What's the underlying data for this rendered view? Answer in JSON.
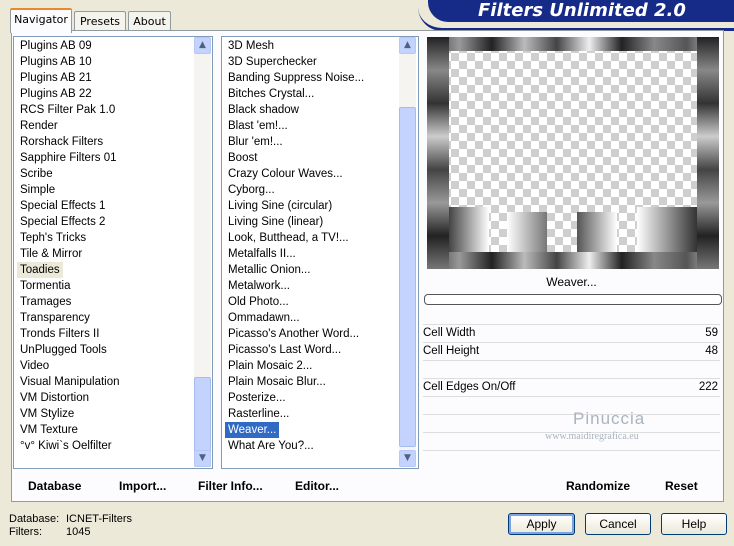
{
  "banner": {
    "title": "Filters Unlimited 2.0"
  },
  "tabs": [
    {
      "label": "Navigator",
      "active": true
    },
    {
      "label": "Presets",
      "active": false
    },
    {
      "label": "About",
      "active": false
    }
  ],
  "categories": {
    "items": [
      "Plugins AB 09",
      "Plugins AB 10",
      "Plugins AB 21",
      "Plugins AB 22",
      "RCS Filter Pak 1.0",
      "Render",
      "Rorshack Filters",
      "Sapphire Filters 01",
      "Scribe",
      "Simple",
      "Special Effects 1",
      "Special Effects 2",
      "Teph's Tricks",
      "Tile & Mirror",
      "Toadies",
      "Tormentia",
      "Tramages",
      "Transparency",
      "Tronds Filters II",
      "UnPlugged Tools",
      "Video",
      "Visual Manipulation",
      "VM Distortion",
      "VM Stylize",
      "VM Texture",
      "°v° Kiwi`s Oelfilter"
    ],
    "selected": "Toadies"
  },
  "filters": {
    "items": [
      "3D Mesh",
      "3D Superchecker",
      "Banding Suppress Noise...",
      "Bitches Crystal...",
      "Black shadow",
      "Blast 'em!...",
      "Blur 'em!...",
      "Boost",
      "Crazy Colour Waves...",
      "Cyborg...",
      "Living Sine (circular)",
      "Living Sine (linear)",
      "Look, Butthead, a TV!...",
      "Metalfalls II...",
      "Metallic Onion...",
      "Metalwork...",
      "Old Photo...",
      "Ommadawn...",
      "Picasso's Another Word...",
      "Picasso's Last Word...",
      "Plain Mosaic 2...",
      "Plain Mosaic Blur...",
      "Posterize...",
      "Rasterline...",
      "Weaver...",
      "What Are You?..."
    ],
    "selected": "Weaver..."
  },
  "preview": {
    "filter_name": "Weaver..."
  },
  "controls": [
    {
      "label": "Cell Width",
      "value": "59",
      "level": 59
    },
    {
      "label": "Cell Height",
      "value": "48",
      "level": 48
    },
    {
      "label": "Cell Edges On/Off",
      "value": "222",
      "level": 222
    }
  ],
  "bottom_buttons": {
    "database": "Database",
    "import": "Import...",
    "filter_info": "Filter Info...",
    "editor": "Editor...",
    "randomize": "Randomize",
    "reset": "Reset"
  },
  "watermark": {
    "name": "Pinuccia",
    "url": "www.maidiregrafica.eu"
  },
  "status": {
    "database_label": "Database:",
    "database_value": "ICNET-Filters",
    "filters_label": "Filters:",
    "filters_value": "1045"
  },
  "dialog_buttons": {
    "apply": "Apply",
    "cancel": "Cancel",
    "help": "Help"
  },
  "colors": {
    "accent": "#316ac5",
    "banner": "#162a88",
    "tab_highlight": "#e68b2c"
  }
}
